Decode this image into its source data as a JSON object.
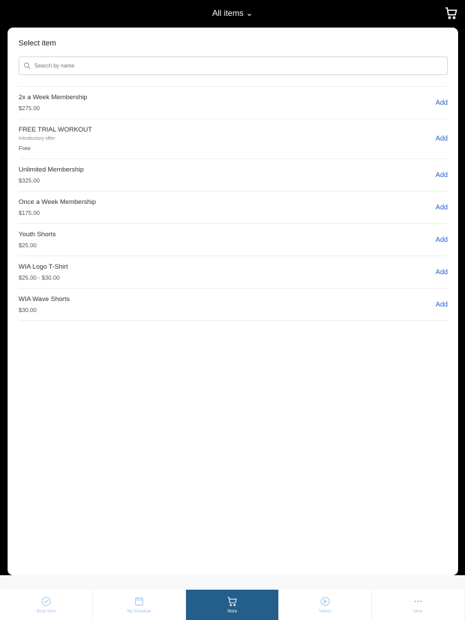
{
  "header": {
    "title": "All items",
    "cart_icon": "cart-icon"
  },
  "sheet": {
    "heading": "Select item",
    "search_placeholder": "Search by name",
    "add_label": "Add",
    "items": [
      {
        "name": "2x a Week Membership",
        "price": "$275.00"
      },
      {
        "name": "FREE TRIAL WORKOUT",
        "subtitle": "Introductory offer",
        "price": "Free"
      },
      {
        "name": "Unlimited Membership",
        "price": "$325.00"
      },
      {
        "name": "Once a Week Membership",
        "price": "$175.00"
      },
      {
        "name": "Youth Shorts",
        "price": "$25.00"
      },
      {
        "name": "WIA Logo T-Shirt",
        "price": "$25.00 - $30.00"
      },
      {
        "name": "WIA Wave Shorts",
        "price": "$30.00"
      }
    ]
  },
  "nav": [
    {
      "label": "Book Now"
    },
    {
      "label": "My Schedule"
    },
    {
      "label": "Store",
      "active": true
    },
    {
      "label": "Videos"
    },
    {
      "label": "More"
    }
  ],
  "colors": {
    "accent": "#2a62c9",
    "active_tab": "#245e8a"
  }
}
